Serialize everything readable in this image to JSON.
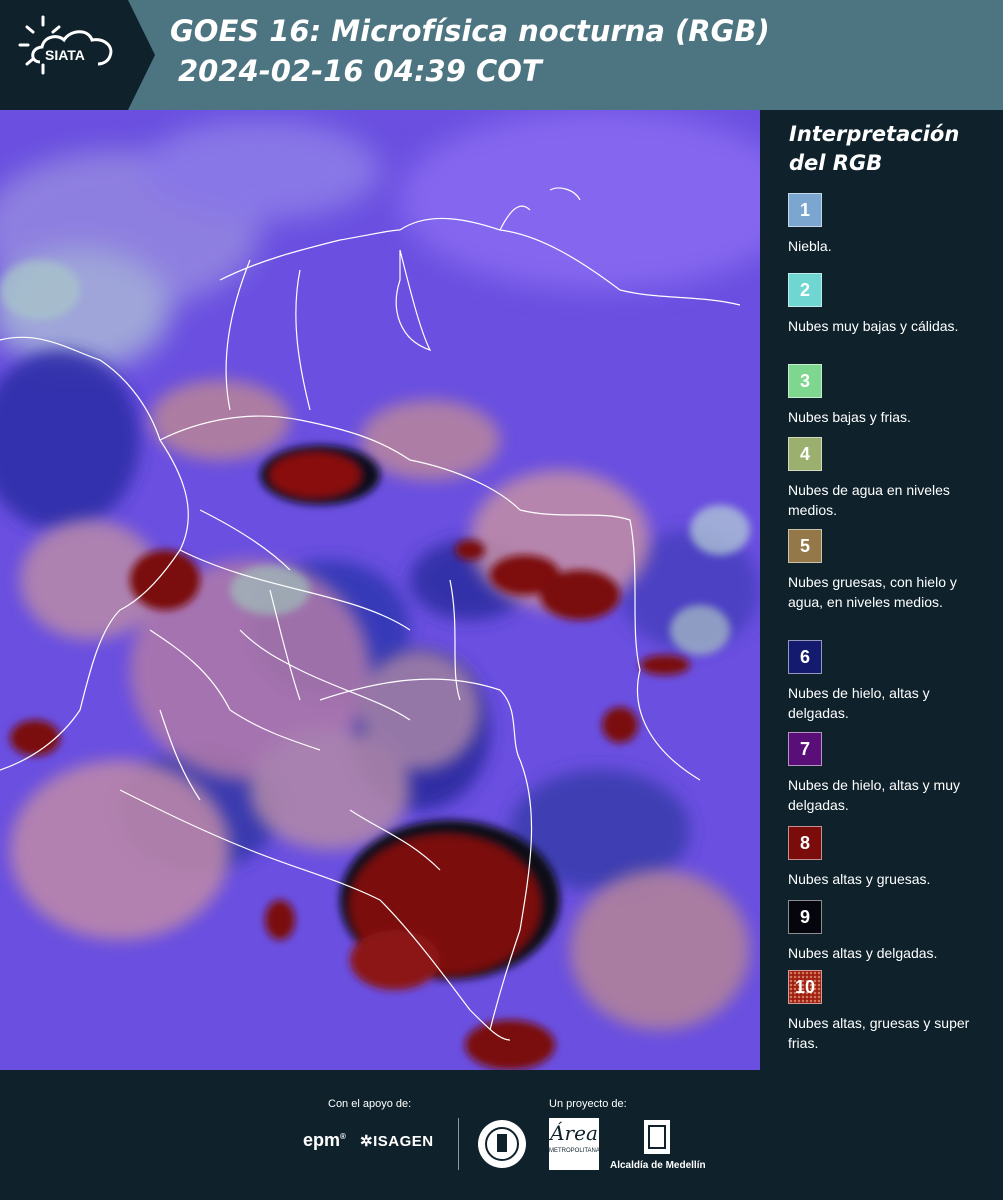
{
  "header": {
    "logo_text": "SIATA",
    "title_line1": "GOES 16: Microfísica nocturna (RGB)",
    "title_line2": "2024-02-16 04:39 COT"
  },
  "map": {
    "background_color": "#6a4fe0",
    "boundary_color": "#ffffff"
  },
  "legend": {
    "title_line1": "Interpretación",
    "title_line2": "del RGB",
    "items": [
      {
        "number": "1",
        "label": "Niebla.",
        "color": "#7aa6cf"
      },
      {
        "number": "2",
        "label": "Nubes muy bajas y cálidas.",
        "color": "#6fd6d2"
      },
      {
        "number": "3",
        "label": "Nubes bajas y frias.",
        "color": "#7fd68f"
      },
      {
        "number": "4",
        "label": "Nubes de agua en niveles medios.",
        "color": "#9bb06e"
      },
      {
        "number": "5",
        "label": "Nubes gruesas, con hielo y agua, en niveles medios.",
        "color": "#94784a"
      },
      {
        "number": "6",
        "label": "Nubes de hielo, altas y delgadas.",
        "color": "#141a6e"
      },
      {
        "number": "7",
        "label": "Nubes de hielo, altas y muy delgadas.",
        "color": "#5a0f78"
      },
      {
        "number": "8",
        "label": "Nubes altas y gruesas.",
        "color": "#7a0c0c"
      },
      {
        "number": "9",
        "label": "Nubes altas y delgadas.",
        "color": "#05050e"
      },
      {
        "number": "10",
        "label": "Nubes altas, gruesas y super frias.",
        "color": "#9e1e12"
      }
    ]
  },
  "footer": {
    "support_label": "Con el apoyo de:",
    "project_label": "Un proyecto de:",
    "sponsor1": "epm",
    "sponsor2": "ISAGEN",
    "partner1_sub": "METROPOLITANA",
    "partner2": "Alcaldía de Medellín"
  }
}
